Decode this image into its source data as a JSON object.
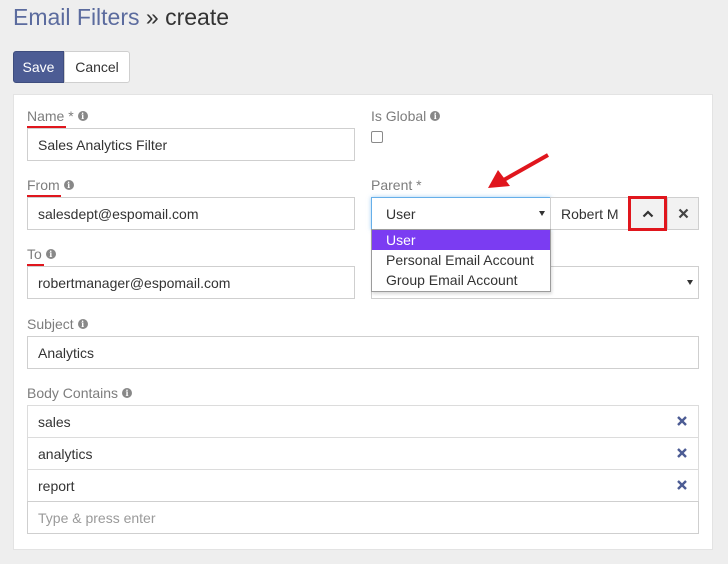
{
  "header": {
    "breadcrumb": "Email Filters",
    "separator": "»",
    "action": "create"
  },
  "toolbar": {
    "save_label": "Save",
    "cancel_label": "Cancel"
  },
  "form": {
    "name": {
      "label": "Name *",
      "value": "Sales Analytics Filter"
    },
    "is_global": {
      "label": "Is Global",
      "checked": false
    },
    "from": {
      "label": "From",
      "value": "salesdept@espomail.com"
    },
    "parent": {
      "label": "Parent *",
      "type_value": "User",
      "record_value": "Robert M",
      "options": [
        "User",
        "Personal Email Account",
        "Group Email Account"
      ],
      "selected_index": 0
    },
    "to": {
      "label": "To",
      "value": "robertmanager@espomail.com"
    },
    "subject": {
      "label": "Subject",
      "value": "Analytics"
    },
    "body_contains": {
      "label": "Body Contains",
      "items": [
        "sales",
        "analytics",
        "report"
      ],
      "placeholder": "Type & press enter"
    }
  },
  "colors": {
    "accent": "#4c5c94",
    "breadcrumb": "#5b6b9e",
    "dropdown_selected": "#7b3cf2",
    "annotation": "#e0161d",
    "tag_remove": "#4c5c94"
  },
  "icons": {
    "info": "info-icon",
    "dropdown_caret": "caret-down-icon",
    "expand": "chevron-up-icon",
    "clear": "close-icon",
    "remove": "close-icon"
  }
}
